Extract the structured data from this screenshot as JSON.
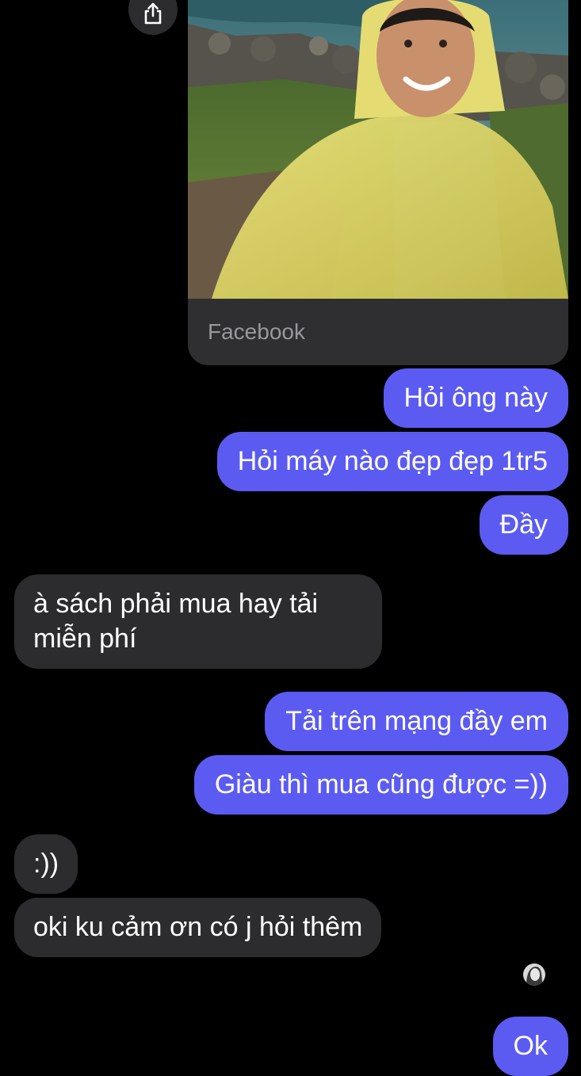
{
  "link_preview": {
    "source": "Facebook",
    "image": "selfie-yellow-raincoat-coast"
  },
  "icons": {
    "share": "share-icon",
    "read_receipt": "avatar-read-receipt"
  },
  "colors": {
    "background": "#000000",
    "outgoing_bubble": "#5b5bf2",
    "incoming_bubble": "#2c2c2e",
    "link_card": "#2f2f31"
  },
  "messages": [
    {
      "side": "out",
      "text": "Hỏi ông này"
    },
    {
      "side": "out",
      "text": "Hỏi máy nào đẹp đẹp 1tr5"
    },
    {
      "side": "out",
      "text": "Đầy"
    },
    {
      "side": "in",
      "text": "à sách phải mua hay tải miễn phí"
    },
    {
      "side": "out",
      "text": "Tải trên mạng đầy em"
    },
    {
      "side": "out",
      "text": "Giàu thì mua cũng được =))"
    },
    {
      "side": "in",
      "text": ":))"
    },
    {
      "side": "in",
      "text": "oki ku cảm ơn có j hỏi thêm"
    },
    {
      "side": "out",
      "text": "Ok"
    }
  ]
}
